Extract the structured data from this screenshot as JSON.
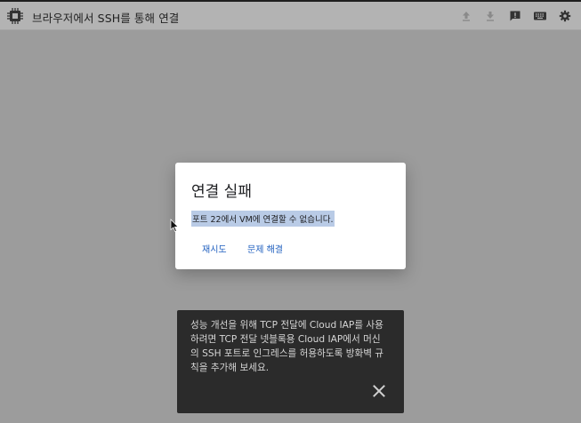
{
  "window": {
    "title": "브라우저에서 SSH를 통해 연결",
    "icons": [
      "chip-icon",
      "upload-icon",
      "download-icon",
      "feedback-icon",
      "keyboard-icon",
      "settings-icon"
    ]
  },
  "dialog": {
    "title": "연결 실패",
    "message": "포트 22에서 VM에 연결할 수 없습니다.",
    "retry_label": "재시도",
    "troubleshoot_label": "문제 해결"
  },
  "snackbar": {
    "text": "성능 개선을 위해 TCP 전달에 Cloud IAP를 사용\n하려면 TCP 전달 넷블록용 Cloud IAP에서 머신\n의 SSH 포트로 인그레스를 허용하도록 방화벽 규\n칙을 추가해 보세요.",
    "close_icon": "close-icon"
  },
  "colors": {
    "overlay": "#9c9c9c",
    "topbar": "#b3b3b3",
    "link": "#1f5fbf",
    "selection": "#b9cbe6",
    "snackbar": "#2b2b2b"
  }
}
